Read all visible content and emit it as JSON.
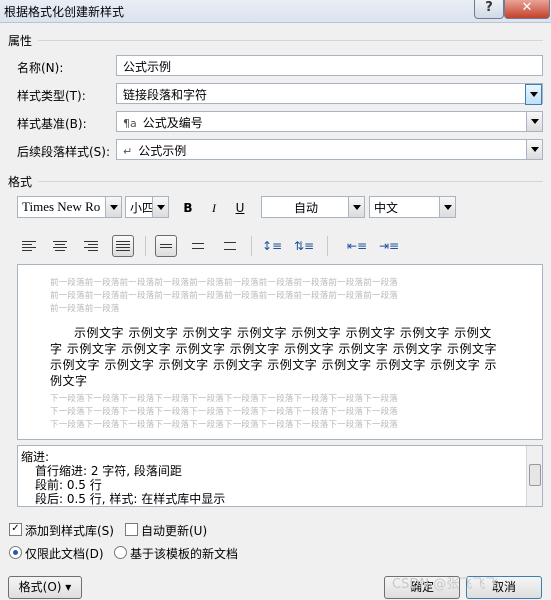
{
  "window": {
    "title": "根据格式化创建新样式",
    "help_icon": "?",
    "close_icon": "✕"
  },
  "properties": {
    "group_label": "属性",
    "name": {
      "label": "名称(N):",
      "value": "公式示例"
    },
    "style_type": {
      "label": "样式类型(T):",
      "value": "链接段落和字符"
    },
    "style_based_on": {
      "label": "样式基准(B):",
      "glyph": "¶a",
      "value": "公式及编号"
    },
    "next_style": {
      "label": "后续段落样式(S):",
      "glyph": "↵",
      "value": "公式示例"
    }
  },
  "format": {
    "group_label": "格式",
    "font": "Times New Ro",
    "size": "小四",
    "bold": "B",
    "italic": "I",
    "underline": "U",
    "color": "自动",
    "language": "中文"
  },
  "preview": {
    "prev_line": "前一段落前一段落前一段落前一段落前一段落前一段落前一段落前一段落前一段落前一段落",
    "prev_last": "前一段落前一段落",
    "sample_text": "示例文字 示例文字 示例文字 示例文字 示例文字 示例文字 示例文字 示例文字 示例文字 示例文字 示例文字 示例文字 示例文字 示例文字 示例文字 示例文字 示例文字 示例文字 示例文字 示例文字 示例文字 示例文字 示例文字 示例文字 示例文字",
    "next_line": "下一段落下一段落下一段落下一段落下一段落下一段落下一段落下一段落下一段落下一段落"
  },
  "description": {
    "line1": "缩进:",
    "line2": "首行缩进:  2 字符, 段落间距",
    "line3": "段前: 0.5 行",
    "line4": "段后: 0.5 行, 样式: 在样式库中显示"
  },
  "options": {
    "add_to_gallery": "添加到样式库(S)",
    "auto_update": "自动更新(U)",
    "only_this_doc": "仅限此文档(D)",
    "new_docs_template": "基于该模板的新文档",
    "add_to_gallery_checked": true,
    "auto_update_checked": false
  },
  "buttons": {
    "format": "格式(O) ▾",
    "ok": "确定",
    "cancel": "取消"
  },
  "watermark": "CSDN @张飞飞飞"
}
